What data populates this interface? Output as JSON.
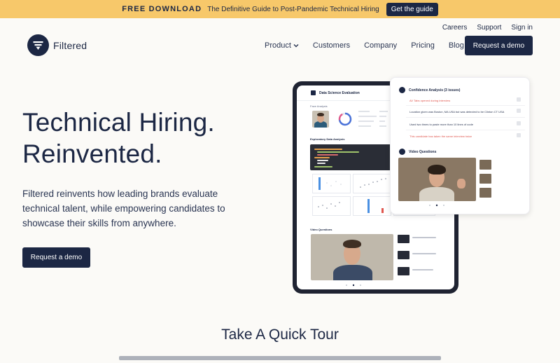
{
  "banner": {
    "strong": "FREE DOWNLOAD",
    "text": "The Definitive Guide to Post-Pandemic Technical Hiring",
    "button": "Get the guide"
  },
  "toplinks": [
    "Careers",
    "Support",
    "Sign in"
  ],
  "logo": {
    "word": "Filtered"
  },
  "nav": {
    "items": [
      "Product",
      "Customers",
      "Company",
      "Pricing",
      "Blog"
    ],
    "cta": "Request a demo"
  },
  "hero": {
    "title_line1": "Technical Hiring.",
    "title_line2": "Reinvented.",
    "subtitle": "Filtered reinvents how leading brands evaluate technical talent, while empowering candidates to showcase their skills from anywhere.",
    "cta": "Request a demo"
  },
  "tablet": {
    "header": "Data Science Evaluation",
    "section1": "Face Analysis",
    "section2": "Exploratory Data Analysis",
    "section3": "Video Questions"
  },
  "card": {
    "heading1": "Confidence Analysis (3 issues)",
    "rows": [
      "AV Tabs opened during interview",
      "Location given was Boston, MA USA but was detected to be Clinton CT USA",
      "Used two times to paste more than 10 lines of code",
      "This candidate has taken the same interview twice"
    ],
    "heading2": "Video Questions"
  },
  "tour": {
    "title": "Take A Quick Tour"
  },
  "colors": {
    "navy": "#1c2744",
    "banner": "#f7c86a",
    "alert": "#e0574f",
    "background": "#fbfaf7"
  }
}
